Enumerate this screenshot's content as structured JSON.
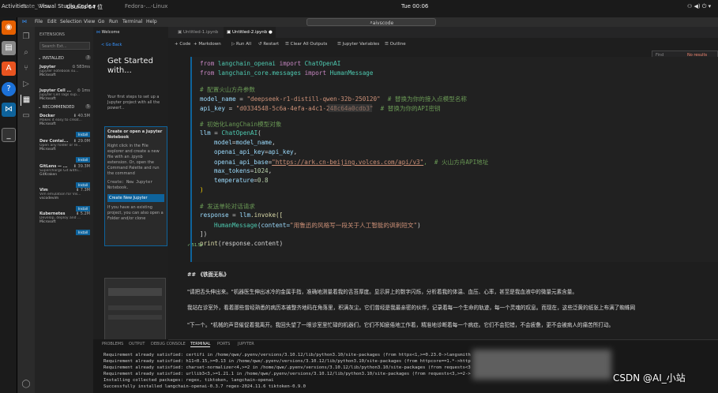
{
  "topbar": {
    "activities": "Activities",
    "app": "Visual Studio Code ▾",
    "clock": "Tue 00:06",
    "left_tab": "Rate_View",
    "chrome_tab1": "Ubuntu 64 位",
    "chrome_tab2": "Fedora-...-Linux"
  },
  "window": {
    "menu": [
      "File",
      "Edit",
      "Selection",
      "View",
      "Go",
      "Run",
      "Terminal",
      "Help"
    ],
    "search": "aivscode"
  },
  "sidebar": {
    "header": "EXTENSIONS",
    "search_placeholder": "Search Ext...",
    "installed": "INSTALLED",
    "installed_count": "3",
    "recommended": "RECOMMENDED",
    "recommended_count": "5",
    "extensions": [
      {
        "name": "Jupyter",
        "stat": "⏲ 583ms",
        "desc": "Jupyter notebook su...",
        "pub": "Microsoft",
        "action": ""
      },
      {
        "name": "Jupyter Cell ...",
        "stat": "⏲ 1ms",
        "desc": "Jupyter Cell Tags sup...",
        "pub": "Microsoft",
        "action": ""
      },
      {
        "name": "Docker",
        "stat": "⬇ 40.5M",
        "desc": "Makes it easy to creat...",
        "pub": "Microsoft",
        "action": "Install"
      },
      {
        "name": "Dev Contai...",
        "stat": "⬇ 29.0M",
        "desc": "Open any folder or re...",
        "pub": "Microsoft",
        "action": "Install"
      },
      {
        "name": "GitLens — ...",
        "stat": "⬇ 39.3M",
        "desc": "Supercharge Git withi...",
        "pub": "GitKraken",
        "action": "Install"
      },
      {
        "name": "Vim",
        "stat": "⬇ 7.3M",
        "desc": "Vim emulation for Vis...",
        "pub": "vscodevim",
        "action": "Install"
      },
      {
        "name": "Kubernetes",
        "stat": "⬇ 5.2M",
        "desc": "Develop, deploy and ...",
        "pub": "Microsoft",
        "action": "Install"
      }
    ]
  },
  "welcome": {
    "tab": "Welcome",
    "back": "< Go Back",
    "title": "Get Started with...",
    "intro": "Your first steps to set up a Jupyter project with all the powerf...",
    "step": "Create or open a Jupyter Notebook",
    "step_text": "Right click in the File explorer and create a new file with an .ipynb extension. Or, open the Command Palette and run the command",
    "cmd": "Create: New Jupyter Notebook.",
    "button": "Create New Jupyter",
    "existing": "If you have an existing project, you can also open a Folder and/or clone"
  },
  "editor": {
    "tabs": [
      "Untitled-1.ipynb",
      "Untitled-2.ipynb"
    ],
    "toolbar": [
      "+ Code",
      "+ Markdown",
      "▷ Run All",
      "↺ Restart",
      "☰ Clear All Outputs",
      "☰ Jupyter Variables",
      "☰ Outline"
    ],
    "find_placeholder": "Find",
    "find_result": "No results",
    "time": "51.5s",
    "code": {
      "l1": [
        "from ",
        "langchain_openai",
        " import ",
        "ChatOpenAI"
      ],
      "l2": [
        "from ",
        "langchain_core.messages",
        " import ",
        "HumanMessage"
      ],
      "c1": "# 配置火山方舟参数",
      "l4": [
        "model_name",
        " = ",
        "\"deepseek-r1-distill-qwen-32b-250120\"",
        "  # 替换为你的接入点模型名称"
      ],
      "l5": [
        "api_key",
        " = ",
        "\"d0334548-5c6a-4efa-a4c1-248c64a0cdb3\"",
        "  # 替换为你的API密钥"
      ],
      "c2": "# 初始化LangChain模型对象",
      "l7": [
        "llm",
        " = ",
        "ChatOpenAI",
        "("
      ],
      "l8": [
        "model",
        "=",
        "model_name",
        ","
      ],
      "l9": [
        "openai_api_key",
        "=",
        "api_key",
        ","
      ],
      "l10": [
        "openai_api_base",
        "=",
        "\"https://ark.cn-beijing.volces.com/api/v3\"",
        ",  # 火山方舟API地址"
      ],
      "l11": [
        "max_tokens",
        "=",
        "1024",
        ","
      ],
      "l12": [
        "temperature",
        "=",
        "0.8"
      ],
      "l13": ")",
      "c3": "# 发送单轮对话请求",
      "l15": [
        "response",
        " = ",
        "llm",
        ".invoke(["
      ],
      "l16": [
        "HumanMessage",
        "(content=",
        "\"用鲁迅的风格写一段关于人工智能的讽刺短文\"",
        ")"
      ],
      "l17": "])",
      "l18": [
        "print",
        "(response.content)"
      ]
    },
    "output": {
      "heading": "##  《铁面无私》",
      "p1": "\"请把舌头伸出来。\"机器医生伸出冰冷的金属手指，准确地测量着我的舌苔厚度。显示屏上的数字闪烁，分析着我的体温、血压、心率，甚至是我血液中的微量元素含量。",
      "p2": "我站在诊室外，看着那些曾经熟悉的病历本被整齐地码在角落里，积满灰尘。它们曾经是我最亲密的伙伴，记录着每一个生命的轨迹，每一个灵魂的叹息。而现在，这些泛黄的纸张上布满了蜘蛛网",
      "p3": "\"下一个。\"机械的声音催促着我离开。我回头望了一眼诊室里忙碌的机器们，它们不知疲倦地工作着，精准地诊断着每一个病症。它们不会犯错，不会疲惫，更不会被病人的痛苦所打动。"
    }
  },
  "panel": {
    "tabs": [
      "PROBLEMS",
      "OUTPUT",
      "DEBUG CONSOLE",
      "TERMINAL",
      "PORTS",
      "JUPYTER"
    ],
    "lines": [
      "Requirement already satisfied: certifi in /home/qwe/.pyenv/versions/3.10.12/lib/python3.10/site-packages (from httpx<1,>=0.23.0->langsmith",
      "Requirement already satisfied: h11<0.15,>=0.13 in /home/qwe/.pyenv/versions/3.10.12/lib/python3.10/site-packages (from httpcore==1.*->http",
      "Requirement already satisfied: charset-normalizer<4,>=2 in /home/qwe/.pyenv/versions/3.10.12/lib/python3.10/site-packages (from requests<3",
      "Requirement already satisfied: urllib3<3,>=1.21.1 in /home/qwe/.pyenv/versions/3.10.12/lib/python3.10/site-packages (from requests<3,>=2->",
      "Installing collected packages: regex, tiktoken, langchain-openai",
      "Successfully installed langchain-openai-0.3.7 regex-2024.11.6 tiktoken-0.9.0"
    ]
  },
  "watermark": "CSDN @AI_小站"
}
